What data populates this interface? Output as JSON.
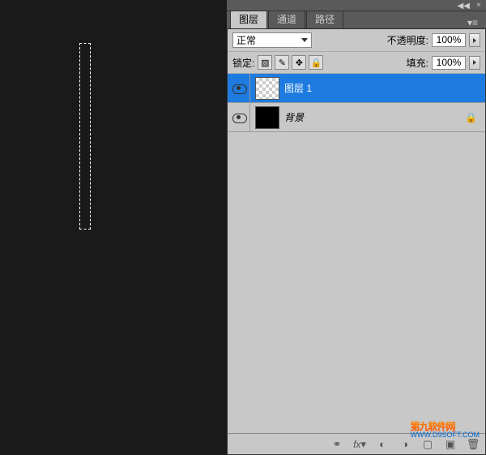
{
  "tabs": {
    "layers": "图层",
    "channels": "通道",
    "paths": "路径"
  },
  "controls": {
    "blend_mode": "正常",
    "opacity_label": "不透明度:",
    "opacity_value": "100%",
    "lock_label": "锁定:",
    "fill_label": "填充:",
    "fill_value": "100%"
  },
  "layers": [
    {
      "name": "图层 1",
      "selected": true,
      "thumb": "checker",
      "locked": false
    },
    {
      "name": "背景",
      "selected": false,
      "thumb": "black",
      "locked": true
    }
  ],
  "watermark": {
    "title": "第九软件网",
    "url": "WWW.D9SOFT.COM"
  }
}
